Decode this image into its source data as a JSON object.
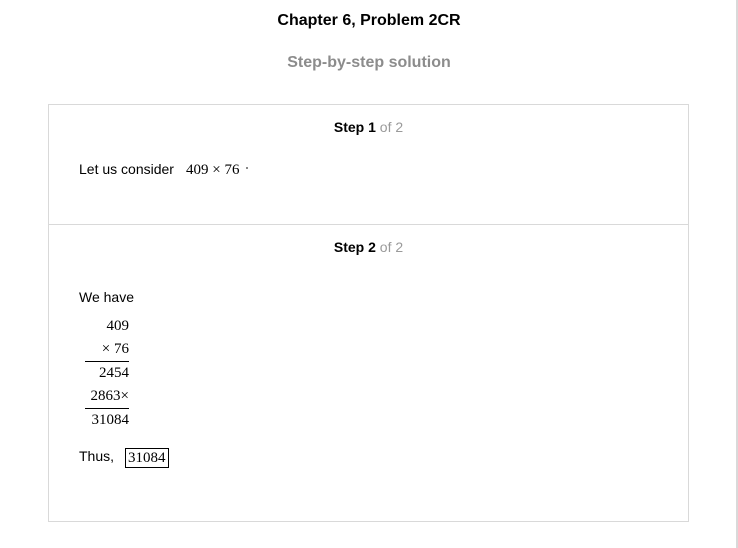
{
  "header": {
    "title": "Chapter 6, Problem 2CR",
    "subtitle": "Step-by-step solution"
  },
  "steps": [
    {
      "label": "Step",
      "number": "1",
      "of": "of 2",
      "text": "Let us consider",
      "expression": "409 × 76"
    },
    {
      "label": "Step",
      "number": "2",
      "of": "of 2",
      "intro": "We have",
      "multiplication": {
        "multiplicand": "409",
        "multiplier": "× 76",
        "partial1": "2454",
        "partial2": "2863×",
        "result": "31084"
      },
      "conclusion_label": "Thus,",
      "answer": "31084"
    }
  ]
}
